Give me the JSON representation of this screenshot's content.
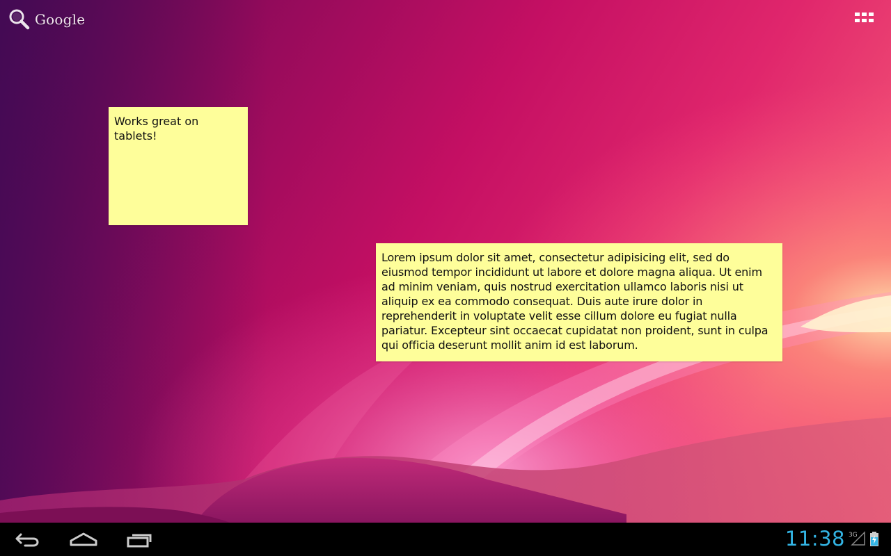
{
  "top_bar": {
    "search_brand": "Google",
    "search_icon": "magnifier-icon",
    "apps_icon": "app-drawer-grid-icon"
  },
  "notes": [
    {
      "text": "Works great on tablets!"
    },
    {
      "text": "Lorem ipsum dolor sit amet, consectetur adipisicing elit, sed do eiusmod tempor incididunt ut labore et dolore magna aliqua. Ut enim ad minim veniam, quis nostrud exercitation ullamco laboris nisi ut aliquip ex ea commodo consequat. Duis aute irure dolor in reprehenderit in voluptate velit esse cillum dolore eu fugiat nulla pariatur. Excepteur sint occaecat cupidatat non proident, sunt in culpa qui officia deserunt mollit anim id est laborum."
    }
  ],
  "system_bar": {
    "back_icon": "back-icon",
    "home_icon": "home-icon",
    "recents_icon": "recent-apps-icon",
    "clock": "11:38",
    "network": "3G",
    "signal_icon": "signal-icon",
    "battery_icon": "battery-charging-icon"
  },
  "colors": {
    "note_background": "#fefe9a",
    "clock": "#33b5e5",
    "system_bar": "#000000"
  }
}
